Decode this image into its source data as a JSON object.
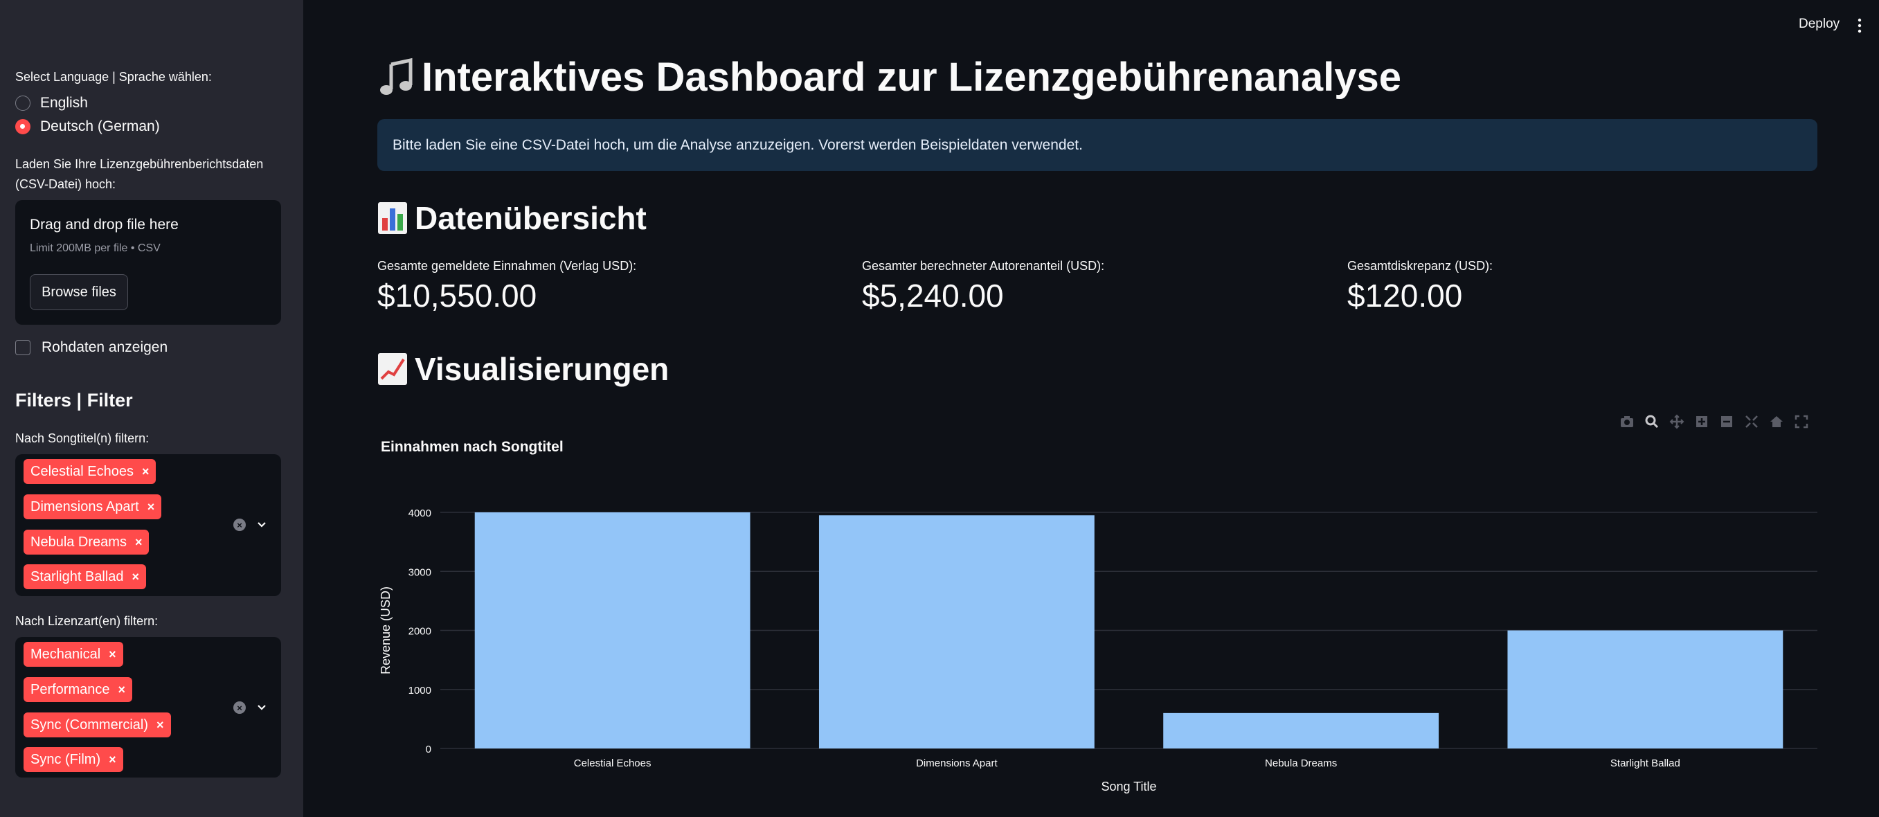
{
  "sidebar": {
    "language_label": "Select Language | Sprache wählen:",
    "language_options": [
      "English",
      "Deutsch (German)"
    ],
    "language_selected": "Deutsch (German)",
    "upload_label_line1": "Laden Sie Ihre Lizenzgebührenberichtsdaten",
    "upload_label_line2": "(CSV-Datei) hoch:",
    "upload_title": "Drag and drop file here",
    "upload_limit": "Limit 200MB per file • CSV",
    "browse_label": "Browse files",
    "raw_checkbox_label": "Rohdaten anzeigen",
    "filters_header": "Filters | Filter",
    "song_filter_label": "Nach Songtitel(n) filtern:",
    "song_tags": [
      "Celestial Echoes",
      "Dimensions Apart",
      "Nebula Dreams",
      "Starlight Ballad"
    ],
    "license_filter_label": "Nach Lizenzart(en) filtern:",
    "license_tags": [
      "Mechanical",
      "Performance",
      "Sync (Commercial)",
      "Sync (Film)"
    ]
  },
  "header": {
    "deploy_label": "Deploy"
  },
  "main": {
    "title": "Interaktives Dashboard zur Lizenzgebührenanalyse",
    "info_text": "Bitte laden Sie eine CSV-Datei hoch, um die Analyse anzuzeigen. Vorerst werden Beispieldaten verwendet.",
    "overview_header": "Datenübersicht",
    "metrics": [
      {
        "label": "Gesamte gemeldete Einnahmen (Verlag USD):",
        "value": "$10,550.00"
      },
      {
        "label": "Gesamter berechneter Autorenanteil (USD):",
        "value": "$5,240.00"
      },
      {
        "label": "Gesamtdiskrepanz (USD):",
        "value": "$120.00"
      }
    ],
    "viz_header": "Visualisierungen"
  },
  "colors": {
    "accent": "#ff4b4b",
    "bar": "#93c5f8",
    "info_bg": "#172d43"
  },
  "chart_data": {
    "type": "bar",
    "title": "Einnahmen nach Songtitel",
    "xlabel": "Song Title",
    "ylabel": "Revenue (USD)",
    "categories": [
      "Celestial Echoes",
      "Dimensions Apart",
      "Nebula Dreams",
      "Starlight Ballad"
    ],
    "values": [
      4000,
      3950,
      600,
      2000
    ],
    "ylim": [
      0,
      4000
    ],
    "yticks": [
      0,
      1000,
      2000,
      3000,
      4000
    ],
    "grid": true
  }
}
